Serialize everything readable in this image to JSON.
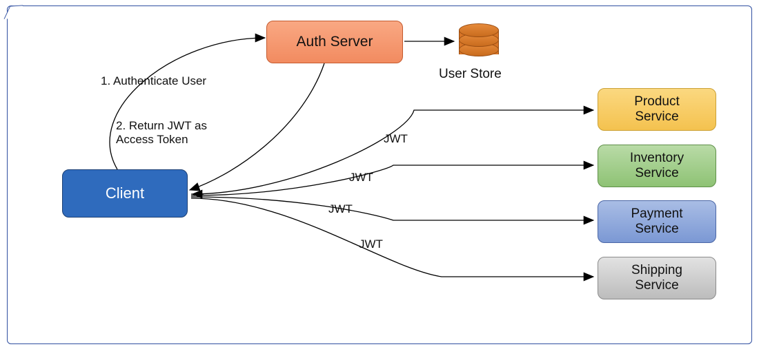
{
  "nodes": {
    "client": "Client",
    "auth": "Auth Server",
    "userstore_label": "User Store",
    "services": {
      "product": "Product\nService",
      "inventory": "Inventory\nService",
      "payment": "Payment\nService",
      "shipping": "Shipping\nService"
    }
  },
  "labels": {
    "step1": "1. Authenticate User",
    "step2_line1": "2. Return JWT as",
    "step2_line2": "Access Token",
    "jwt": "JWT"
  },
  "flows": [
    {
      "from": "client",
      "to": "auth",
      "label_key": "step1"
    },
    {
      "from": "auth",
      "to": "client",
      "label_key": "step2"
    },
    {
      "from": "auth",
      "to": "userstore"
    },
    {
      "from": "client",
      "to": "product",
      "label_key": "jwt"
    },
    {
      "from": "client",
      "to": "inventory",
      "label_key": "jwt"
    },
    {
      "from": "client",
      "to": "payment",
      "label_key": "jwt"
    },
    {
      "from": "client",
      "to": "shipping",
      "label_key": "jwt"
    }
  ],
  "colors": {
    "client": "#2f6bbd",
    "auth": "#f28b60",
    "product": "#f4c24f",
    "inventory": "#8ec274",
    "payment": "#7b98d4",
    "shipping": "#bcbcbc",
    "userstore": "#d77426",
    "frame": "#2e4ea0"
  }
}
